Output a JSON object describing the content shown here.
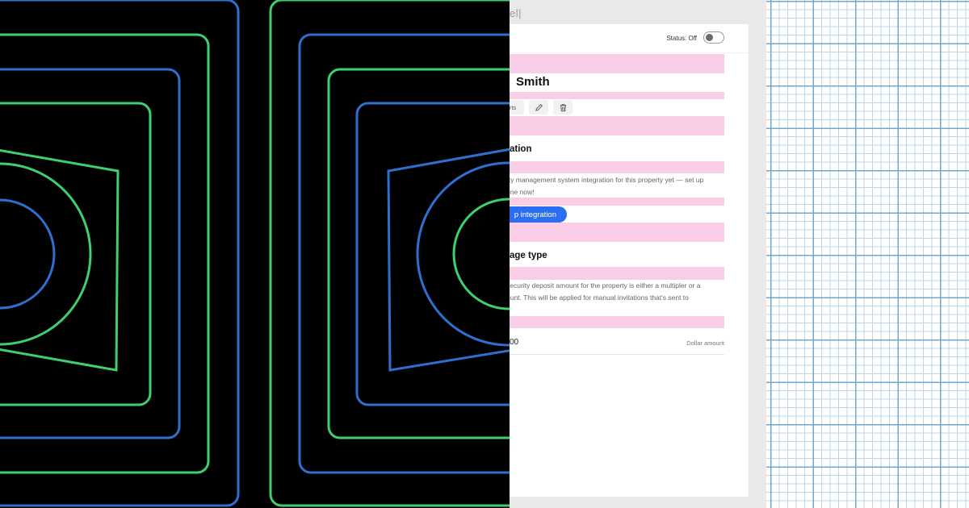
{
  "app": {
    "top_text": "el|",
    "status_label": "Status: Off",
    "status_on": false
  },
  "person": {
    "name": "Smith"
  },
  "actions": {
    "first_label": "rts",
    "icons": [
      "pencil-icon",
      "trash-icon"
    ]
  },
  "integration": {
    "title": "ation",
    "line1": "rty management system integration for this property yet — set up",
    "line2": "one now!",
    "button_label": "p integration"
  },
  "deposit": {
    "title": "age type",
    "line1": "security deposit amount for the property is either a multipler or a",
    "line2": "ount. This will be applied for manual invitations that's sent to",
    "value": "00",
    "unit_label": "Dollar amount"
  },
  "colors": {
    "artwork_bg": "#000000",
    "stroke_blue": "#2f6fd0",
    "stroke_green": "#3ecf6e",
    "highlight_pink": "#f9cde6",
    "accent_button": "#2b6ef2",
    "grid_major": "#6fa7cf",
    "grid_minor": "#b9d6ea"
  }
}
